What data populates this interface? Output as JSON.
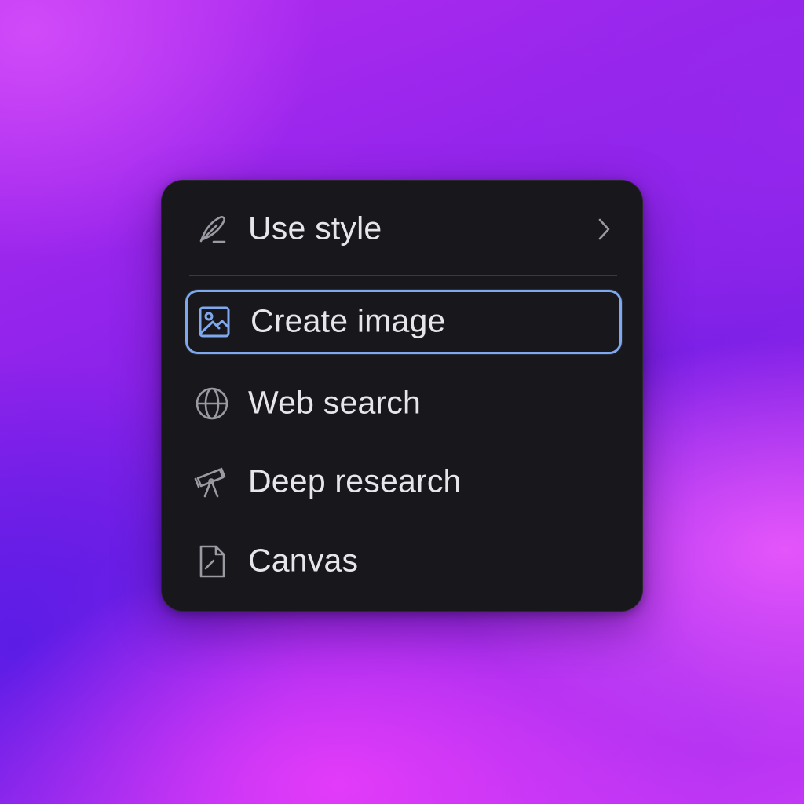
{
  "menu": {
    "items": [
      {
        "label": "Use style",
        "icon": "feather-pen-icon",
        "has_submenu": true
      },
      {
        "label": "Create image",
        "icon": "image-icon",
        "selected": true
      },
      {
        "label": "Web search",
        "icon": "globe-icon"
      },
      {
        "label": "Deep research",
        "icon": "telescope-icon"
      },
      {
        "label": "Canvas",
        "icon": "document-icon"
      }
    ]
  },
  "colors": {
    "menu_background": "#18181c",
    "label_text": "#e6e6ea",
    "icon_default": "#9a9aa2",
    "selected_accent": "#7fa8ee",
    "divider": "#3a3a40"
  }
}
